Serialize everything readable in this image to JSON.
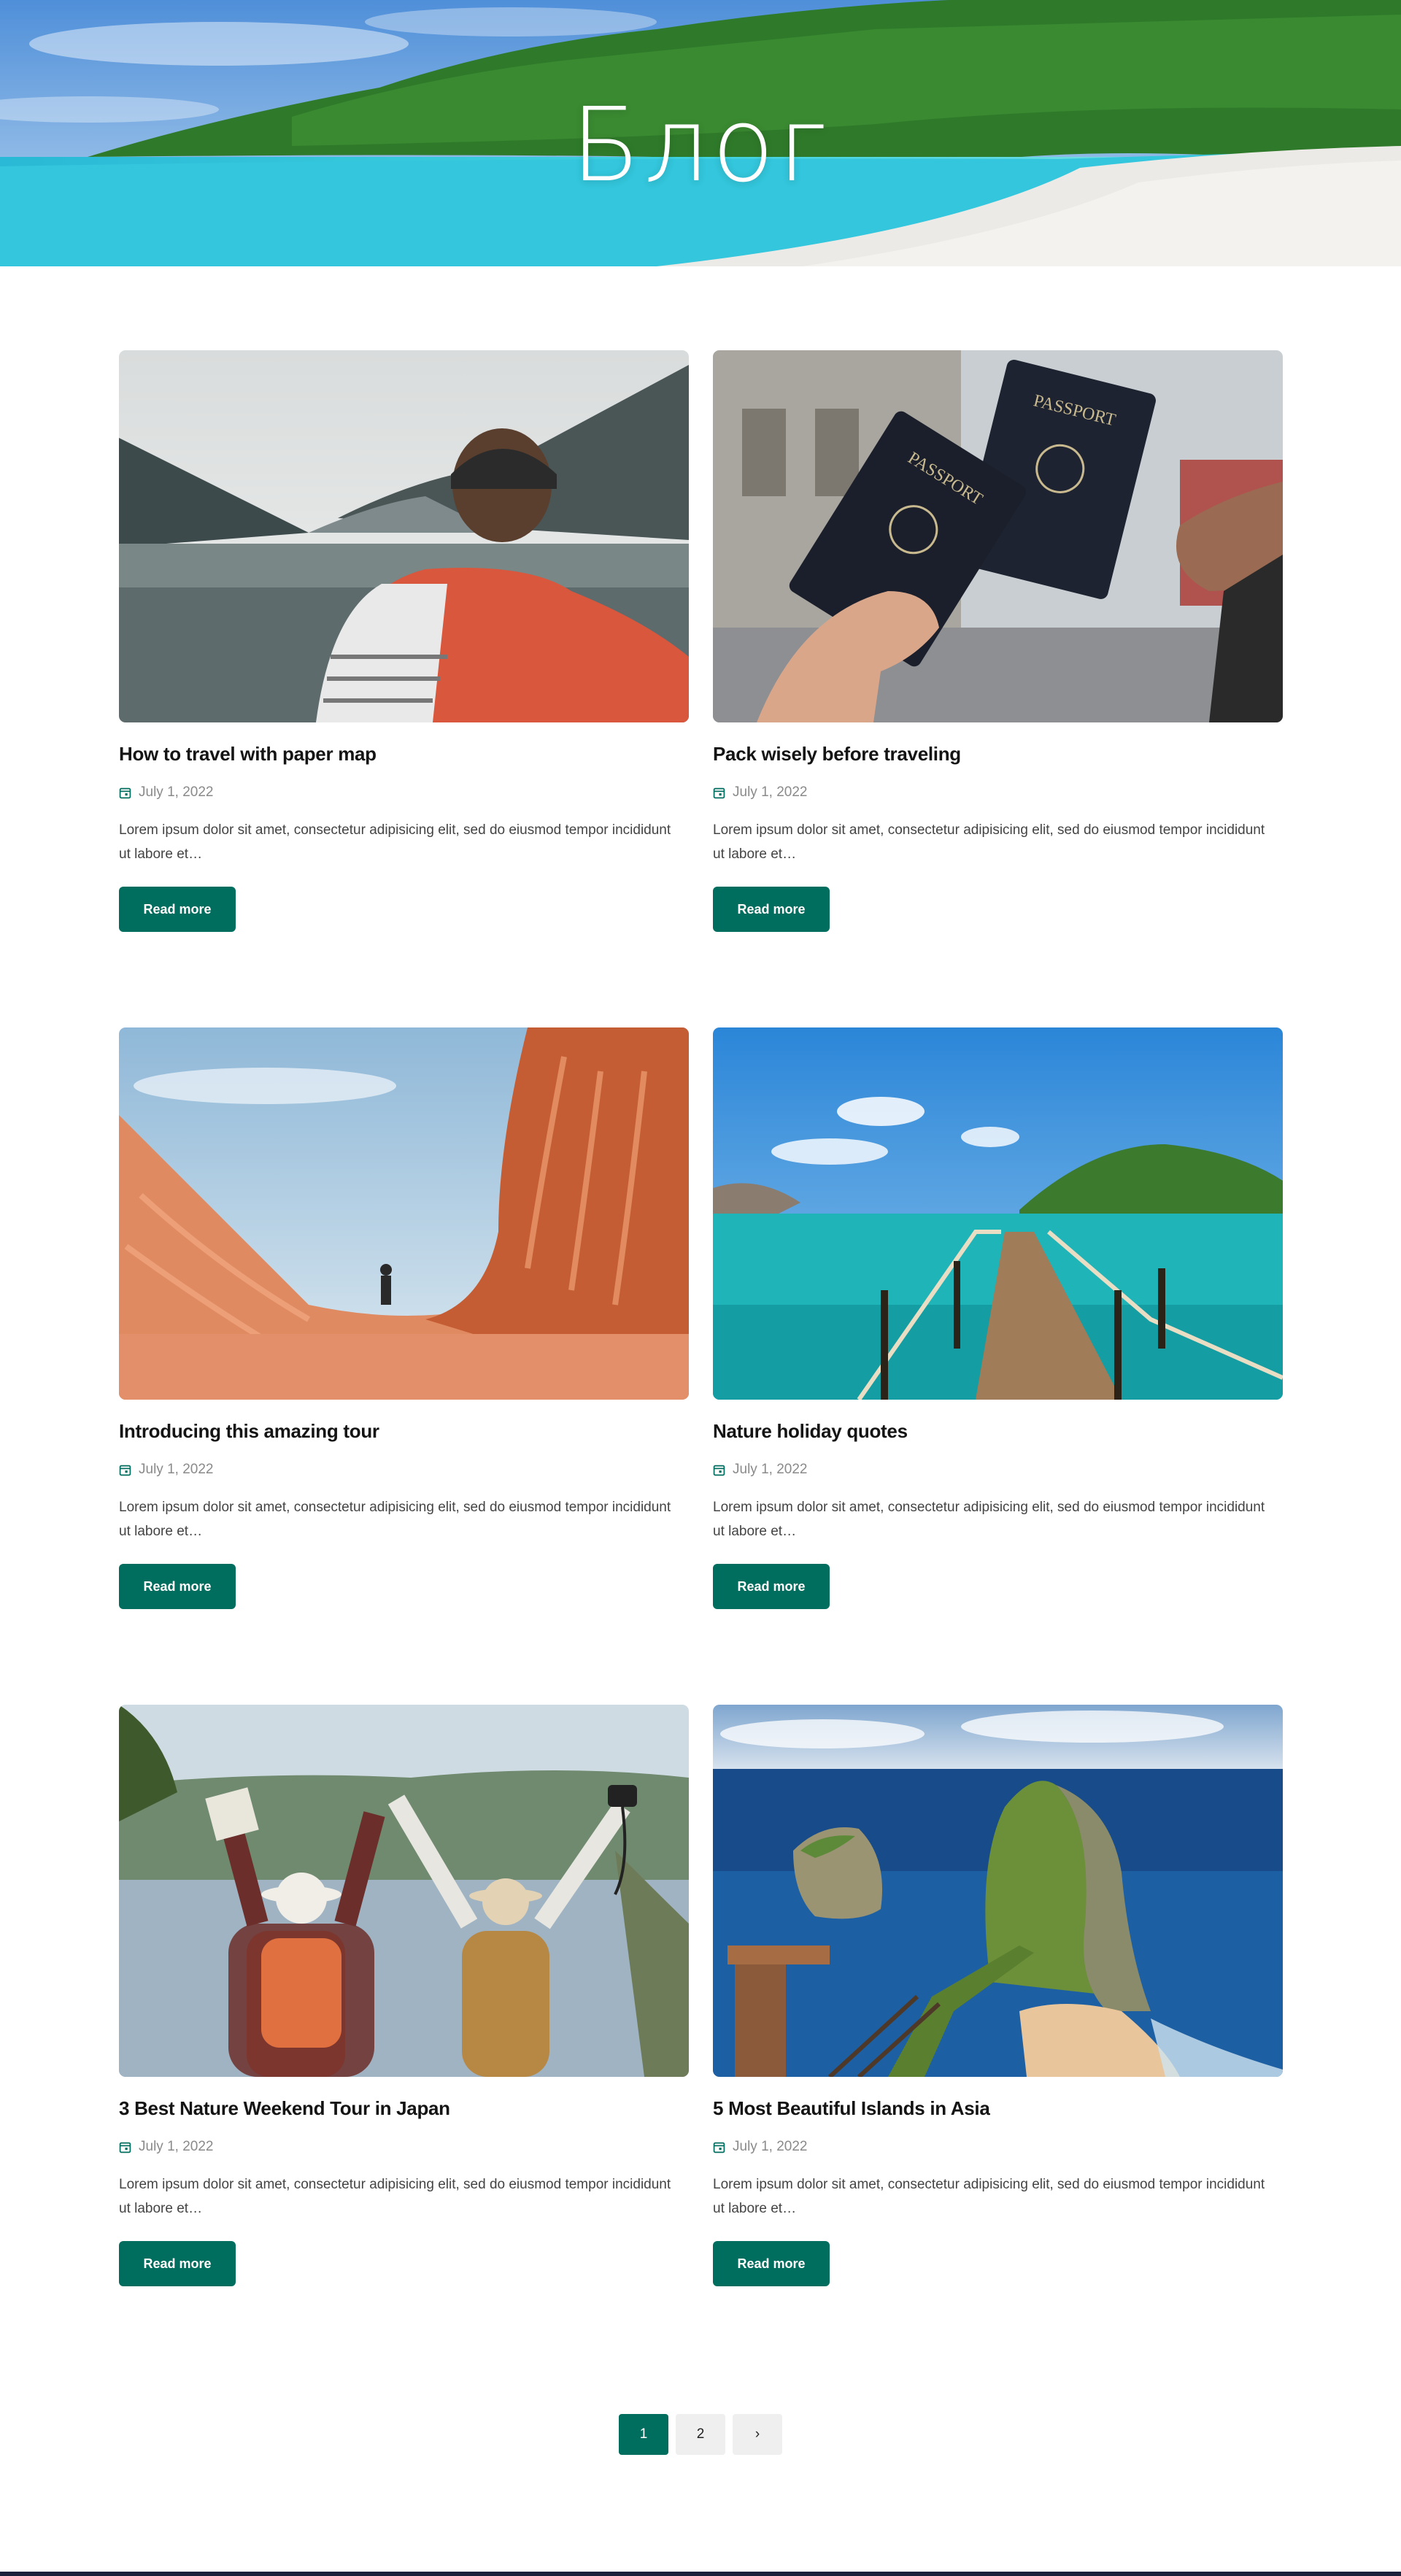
{
  "hero": {
    "title": "Блог"
  },
  "posts": [
    {
      "title": "How to travel with paper map",
      "date": "July 1, 2022",
      "excerpt": "Lorem ipsum dolor sit amet, consectetur adipisicing elit, sed do eiusmod tempor incididunt ut labore et…",
      "button": "Read more",
      "image": "hiker-backpack-lake"
    },
    {
      "title": "Pack wisely before traveling",
      "date": "July 1, 2022",
      "excerpt": "Lorem ipsum dolor sit amet, consectetur adipisicing elit, sed do eiusmod tempor incididunt ut labore et…",
      "button": "Read more",
      "image": "passports"
    },
    {
      "title": "Introducing this amazing tour",
      "date": "July 1, 2022",
      "excerpt": "Lorem ipsum dolor sit amet, consectetur adipisicing elit, sed do eiusmod tempor incididunt ut labore et…",
      "button": "Read more",
      "image": "canyon-wave"
    },
    {
      "title": "Nature holiday quotes",
      "date": "July 1, 2022",
      "excerpt": "Lorem ipsum dolor sit amet, consectetur adipisicing elit, sed do eiusmod tempor incididunt ut labore et…",
      "button": "Read more",
      "image": "wooden-pier"
    },
    {
      "title": "3 Best Nature Weekend Tour in Japan",
      "date": "July 1, 2022",
      "excerpt": "Lorem ipsum dolor sit amet, consectetur adipisicing elit, sed do eiusmod tempor incididunt ut labore et…",
      "button": "Read more",
      "image": "couple-hikers"
    },
    {
      "title": "5 Most Beautiful Islands in Asia",
      "date": "July 1, 2022",
      "excerpt": "Lorem ipsum dolor sit amet, consectetur adipisicing elit, sed do eiusmod tempor incididunt ut labore et…",
      "button": "Read more",
      "image": "island-cliff"
    }
  ],
  "pagination": {
    "pages": [
      "1",
      "2"
    ],
    "current": "1",
    "next_icon": "chevron-right-icon",
    "next_label": "›"
  },
  "colors": {
    "accent": "#006e5f",
    "page_inactive": "#efefef",
    "date_icon": "#006e5f"
  },
  "icons": {
    "date": "calendar-icon"
  }
}
